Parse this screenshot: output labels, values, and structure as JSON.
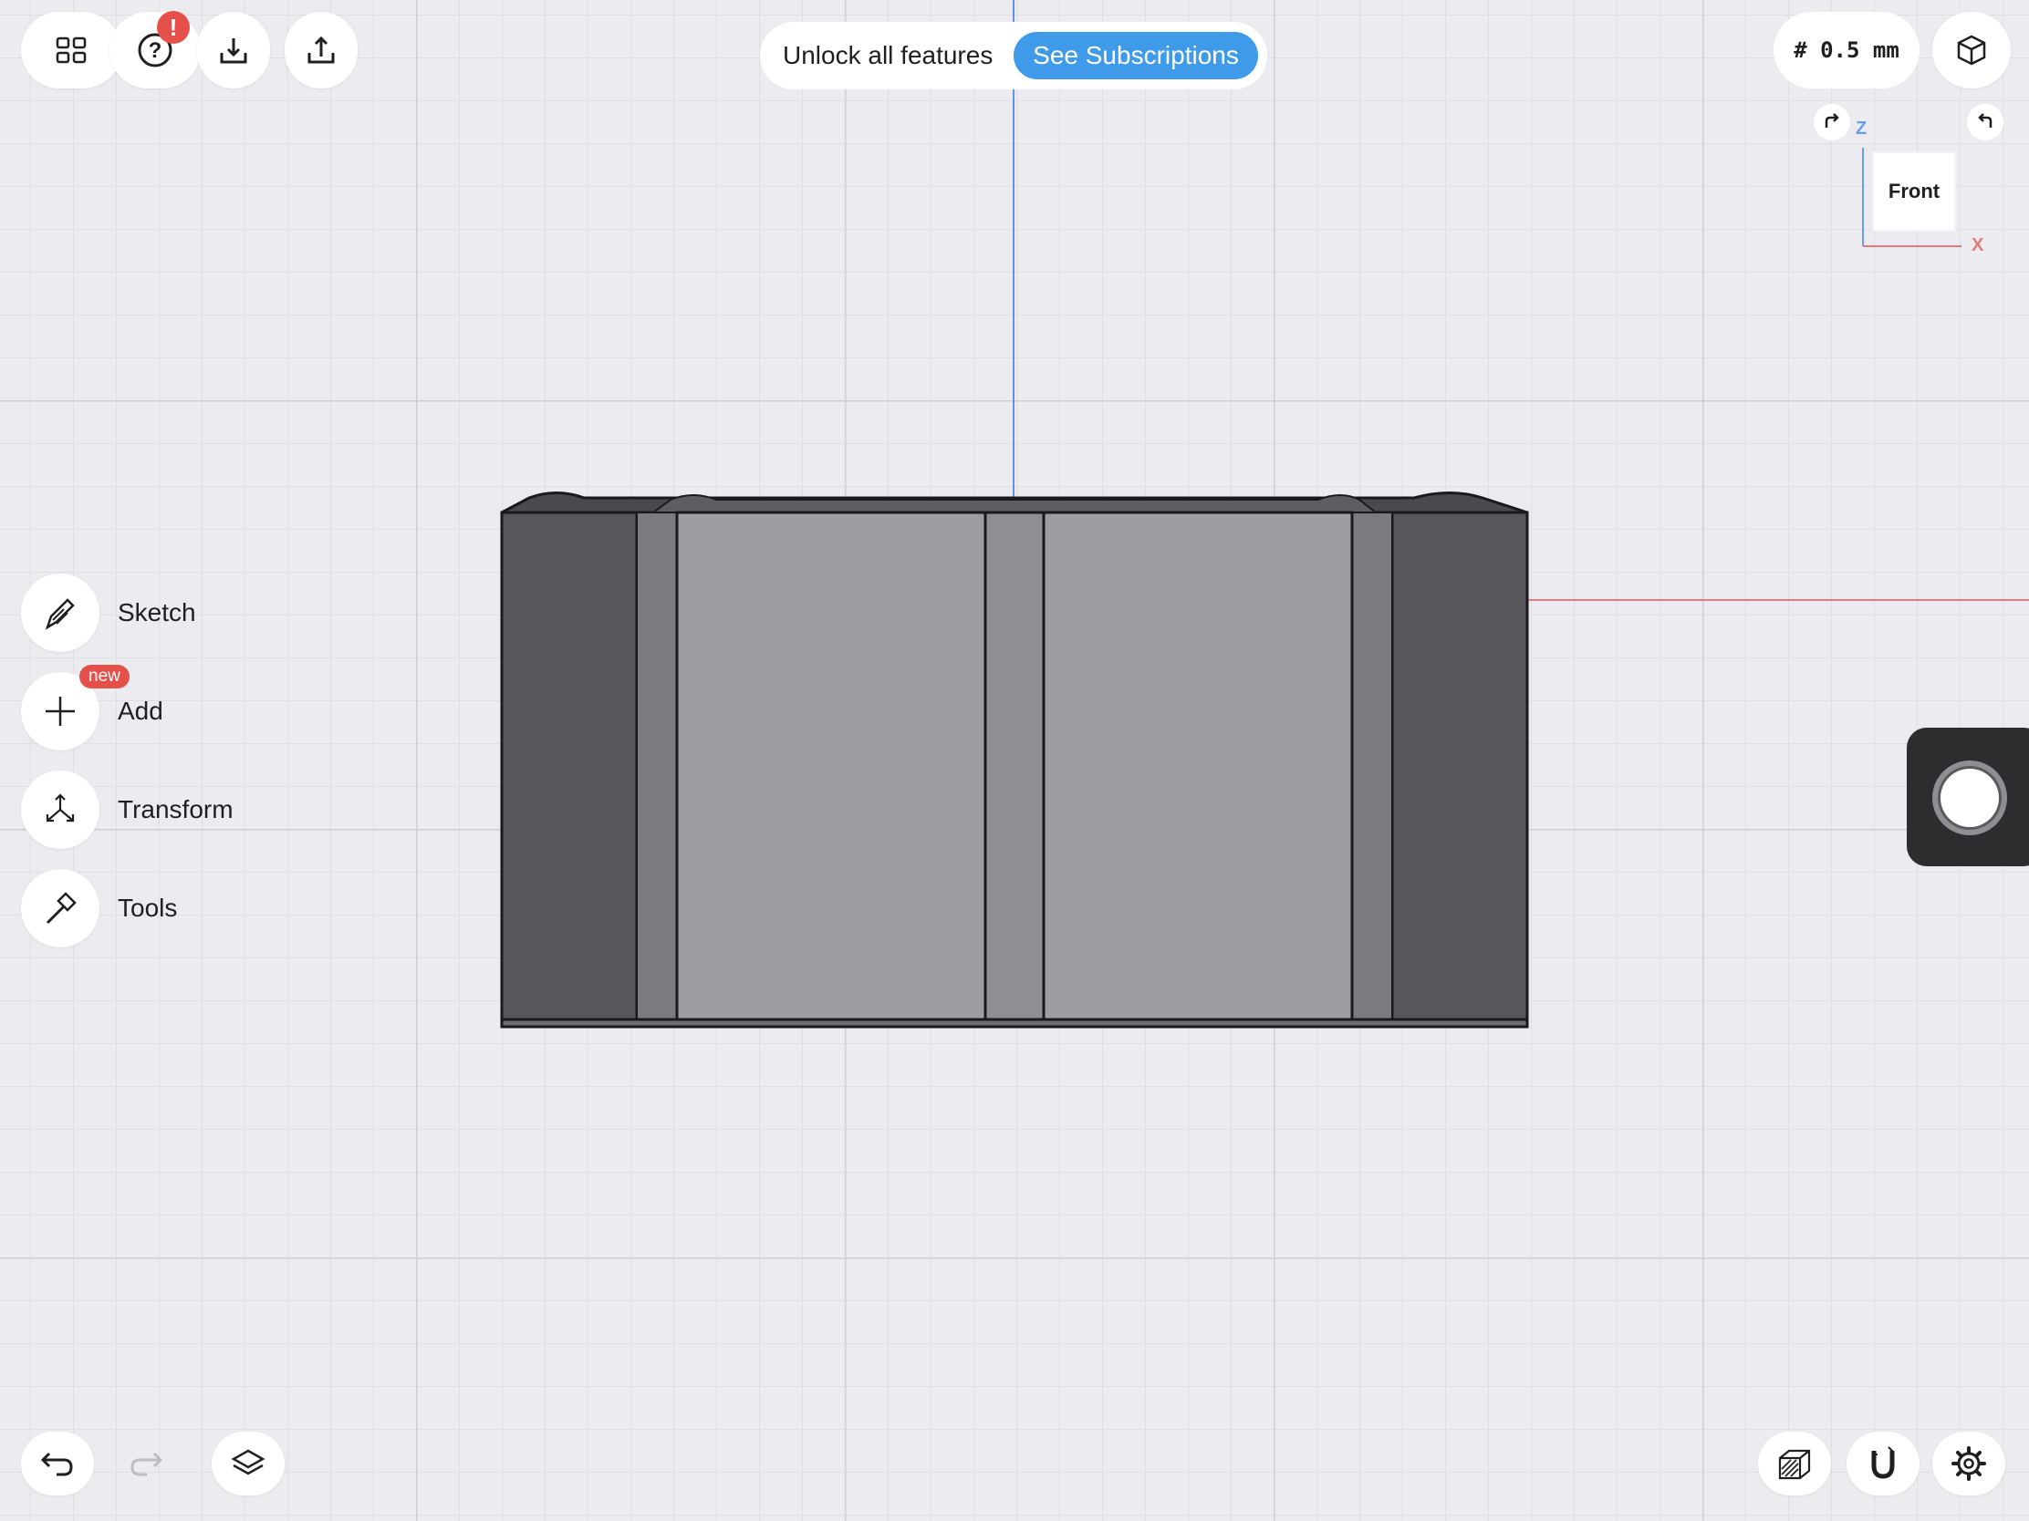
{
  "toolbar": {
    "gallery_icon": "grid-icon",
    "help_icon": "question-mark-icon",
    "help_badge": "!",
    "import_icon": "download-icon",
    "export_icon": "share-icon"
  },
  "promo": {
    "text": "Unlock all features",
    "button_label": "See Subscriptions"
  },
  "grid_size": "# 0.5 mm",
  "view_cube": {
    "face_label": "Front",
    "z_label": "Z",
    "x_label": "X"
  },
  "side_menu": {
    "items": [
      {
        "label": "Sketch",
        "icon": "pencil-icon"
      },
      {
        "label": "Add",
        "icon": "plus-icon",
        "badge": "new"
      },
      {
        "label": "Transform",
        "icon": "transform-arrows-icon"
      },
      {
        "label": "Tools",
        "icon": "hammer-icon"
      }
    ]
  },
  "bottom_bar": {
    "undo_icon": "undo-icon",
    "redo_icon": "redo-icon",
    "layers_icon": "layers-icon",
    "material_icon": "hatch-cube-icon",
    "snap_icon": "magnet-icon",
    "settings_icon": "gear-icon"
  },
  "colors": {
    "accent": "#3f9ae9",
    "alert": "#e5504a",
    "z_axis": "#6b9ee8",
    "x_axis": "#e07c7c"
  }
}
